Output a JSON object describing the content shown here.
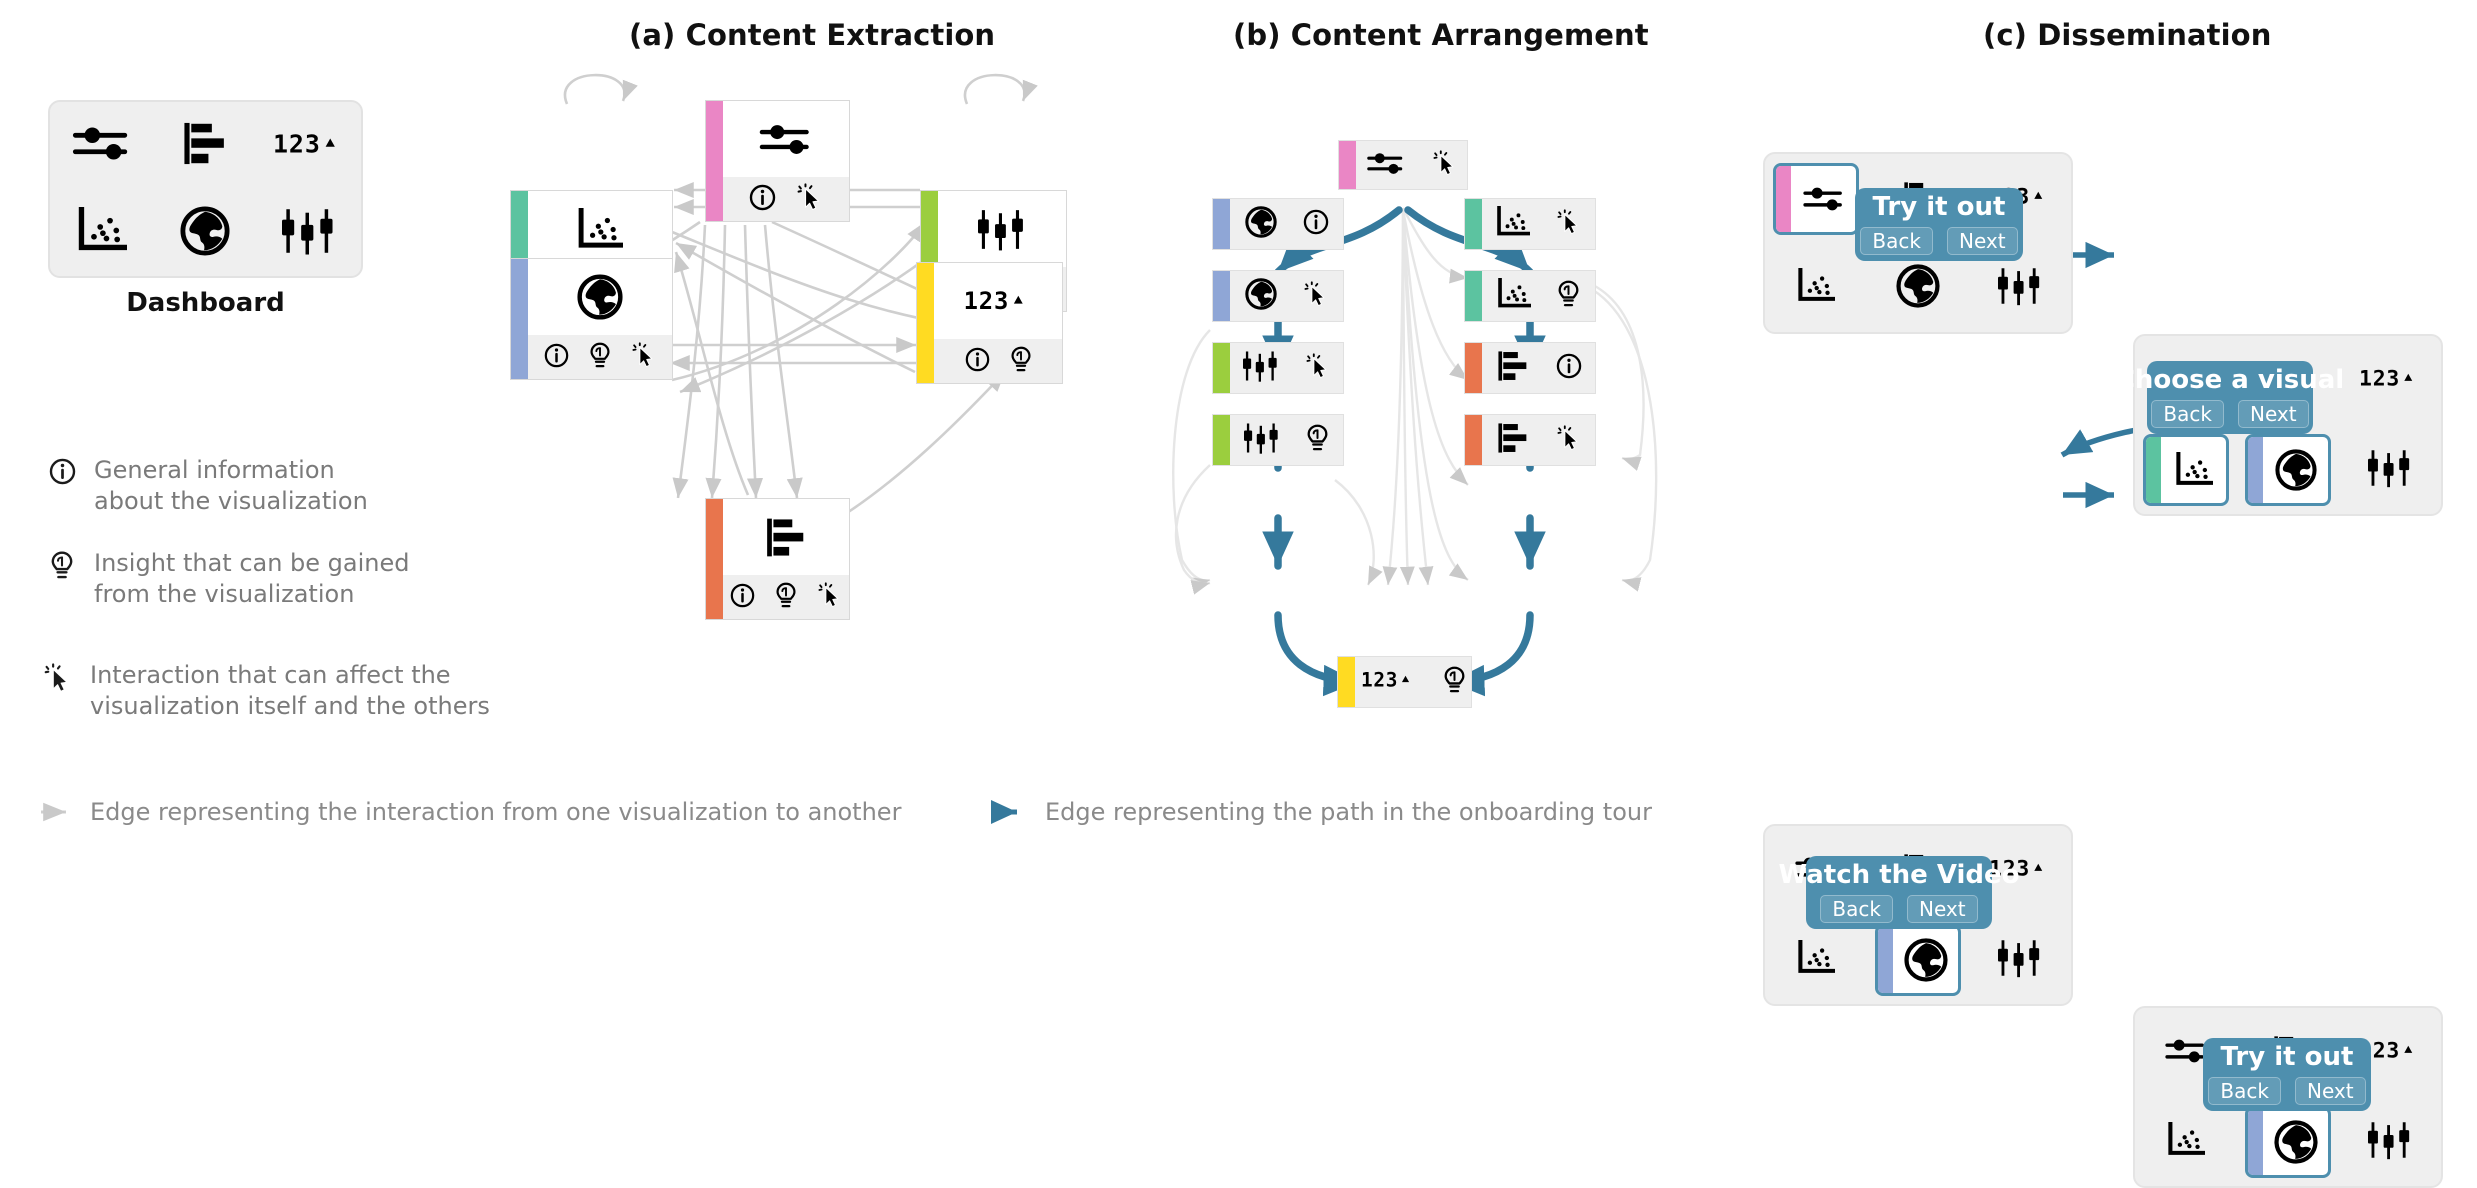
{
  "panels": [
    {
      "id": "a",
      "title": "(a) Content Extraction"
    },
    {
      "id": "b",
      "title": "(b) Content Arrangement"
    },
    {
      "id": "c",
      "title": "(c) Dissemination"
    }
  ],
  "dashboard": {
    "label": "Dashboard",
    "icons": [
      "sliders-icon",
      "bar-chart-icon",
      "number-icon",
      "scatter-plot-icon",
      "globe-icon",
      "candlestick-icon"
    ]
  },
  "legend": {
    "items": [
      {
        "icon": "info-icon",
        "text": "General information\nabout the visualization",
        "line1": "General information",
        "line2": "about the visualization"
      },
      {
        "icon": "lightbulb-icon",
        "text": "Insight that can be gained\nfrom the visualization",
        "line1": "Insight that can be gained",
        "line2": "from the visualization"
      },
      {
        "icon": "cursor-icon",
        "text": "Interaction that can affect the\nvisualization itself and the others",
        "line1": "Interaction that can affect the",
        "line2": "visualization itself and the others"
      }
    ]
  },
  "bottom_legend": {
    "interaction_edge": "Edge representing the interaction from one visualization to another",
    "tour_edge": "Edge representing the path in the onboarding tour"
  },
  "colors": {
    "pink": "#ea86c5",
    "teal": "#5cc3a0",
    "lime": "#9bce3e",
    "blue": "#8fa6d6",
    "orange": "#e8754d",
    "yellow": "#ffdb22",
    "tour_edge": "#35799c",
    "interaction_edge": "#cfcfcf",
    "panel_bg": "#efefef",
    "card_border": "#e2e2e2"
  },
  "panel_a": {
    "nodes": [
      {
        "name": "sliders",
        "viz": "sliders-icon",
        "stripe": "pink",
        "actions": [
          "info-icon",
          "cursor-icon"
        ]
      },
      {
        "name": "scatter",
        "viz": "scatter-plot-icon",
        "stripe": "teal",
        "actions": [
          "info-icon",
          "lightbulb-icon",
          "cursor-icon"
        ]
      },
      {
        "name": "candlestick",
        "viz": "candlestick-icon",
        "stripe": "lime",
        "actions": [
          "info-icon",
          "lightbulb-icon",
          "cursor-icon"
        ]
      },
      {
        "name": "globe",
        "viz": "globe-icon",
        "stripe": "blue",
        "actions": [
          "info-icon",
          "lightbulb-icon",
          "cursor-icon"
        ]
      },
      {
        "name": "number",
        "viz": "number-icon",
        "stripe": "yellow",
        "actions": [
          "info-icon",
          "lightbulb-icon"
        ]
      },
      {
        "name": "bar",
        "viz": "bar-chart-icon",
        "stripe": "orange",
        "actions": [
          "info-icon",
          "lightbulb-icon",
          "cursor-icon"
        ]
      }
    ]
  },
  "panel_b": {
    "nodes": [
      {
        "name": "sliders-cursor",
        "viz": "sliders-icon",
        "stripe": "pink",
        "action": "cursor-icon"
      },
      {
        "name": "globe-info",
        "viz": "globe-icon",
        "stripe": "blue",
        "action": "info-icon"
      },
      {
        "name": "globe-cursor",
        "viz": "globe-icon",
        "stripe": "blue",
        "action": "cursor-icon"
      },
      {
        "name": "candlestick-cursor",
        "viz": "candlestick-icon",
        "stripe": "lime",
        "action": "cursor-icon"
      },
      {
        "name": "candlestick-insight",
        "viz": "candlestick-icon",
        "stripe": "lime",
        "action": "lightbulb-icon"
      },
      {
        "name": "scatter-cursor",
        "viz": "scatter-plot-icon",
        "stripe": "teal",
        "action": "cursor-icon"
      },
      {
        "name": "scatter-insight",
        "viz": "scatter-plot-icon",
        "stripe": "teal",
        "action": "lightbulb-icon"
      },
      {
        "name": "bar-info",
        "viz": "bar-chart-icon",
        "stripe": "orange",
        "action": "info-icon"
      },
      {
        "name": "bar-cursor",
        "viz": "bar-chart-icon",
        "stripe": "orange",
        "action": "cursor-icon"
      },
      {
        "name": "number-insight",
        "viz": "number-icon",
        "stripe": "yellow",
        "action": "lightbulb-icon"
      }
    ]
  },
  "panel_c": {
    "back_label": "Back",
    "next_label": "Next",
    "cards": [
      {
        "id": "c1",
        "tooltip": "Try it out",
        "highlight": "sliders",
        "stripe": "pink"
      },
      {
        "id": "c2",
        "tooltip": "Choose a visual",
        "highlight": "scatter-and-globe",
        "stripe": "teal"
      },
      {
        "id": "c3",
        "tooltip": "Watch the Video",
        "highlight": "globe",
        "stripe": "blue"
      },
      {
        "id": "c4",
        "tooltip": "Try it out",
        "highlight": "globe",
        "stripe": "blue"
      }
    ]
  }
}
